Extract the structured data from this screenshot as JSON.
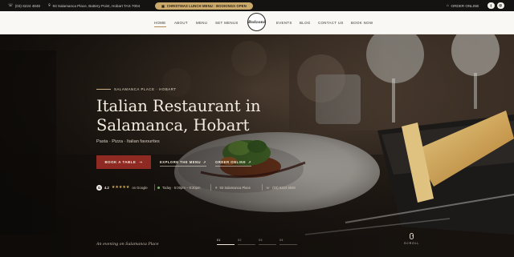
{
  "topbar": {
    "phone": "(03) 6224 4848",
    "address": "93 Salamanca Place, Battery Point, Hobart TAS 7004",
    "promo_label": "CHRISTMAS LUNCH MENU · BOOKINGS OPEN",
    "order_online_label": "ORDER ONLINE",
    "social": [
      "f",
      "ig"
    ]
  },
  "nav": {
    "left": [
      "HOME",
      "ABOUT",
      "MENU",
      "SET MENUS"
    ],
    "right": [
      "EVENTS",
      "BLOG",
      "CONTACT US",
      "BOOK NOW"
    ],
    "active": "HOME",
    "logo_text": "Bolzoni"
  },
  "hero": {
    "eyebrow": "SALAMANCA PLACE · HOBART",
    "title_line1": "Italian Restaurant in",
    "title_line2": "Salamanca, Hobart",
    "subtitle": "Pasta · Pizza · Italian favourites",
    "book_button": "BOOK A TABLE",
    "explore_link": "EXPLORE THE MENU",
    "order_link": "ORDER ONLINE",
    "rating": "4.2",
    "stars": "★★★★★",
    "rating_source": "on Google",
    "hours": "Today · 5:00pm – 9:30pm",
    "location": "93 Salamanca Place",
    "phone": "(03) 6224 4848",
    "caption": "An evening on Salamanca Place",
    "slides": [
      "01",
      "02",
      "03",
      "04"
    ],
    "active_slide": 0,
    "scroll_label": "SCROLL"
  },
  "colors": {
    "accent_gold": "#c9a86a",
    "cta_red": "#8e2a22",
    "nav_bg": "#faf8f5",
    "topbar_bg": "#141312"
  }
}
